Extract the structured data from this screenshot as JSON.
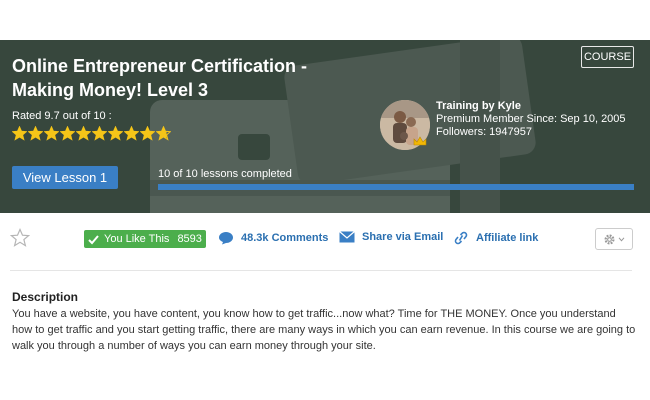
{
  "hero": {
    "badge": "COURSE",
    "title": "Online Entrepreneur Certification - Making Money! Level 3",
    "rating_text": "Rated 9.7 out of 10 :",
    "rating_value": 9.7,
    "rating_max": 10,
    "trainer": {
      "name": "Training by Kyle",
      "member_since": "Premium Member Since: Sep 10, 2005",
      "followers": "Followers: 1947957"
    },
    "view_button": "View Lesson 1",
    "progress_label": "10 of 10 lessons completed",
    "progress_fraction": 1.0
  },
  "actions": {
    "like_label": "You Like This",
    "like_count": "8593",
    "comments": "48.3k Comments",
    "share": "Share via Email",
    "affiliate": "Affiliate link"
  },
  "description": {
    "heading": "Description",
    "text": "You have a website, you have content, you know how to get traffic...now what? Time for THE MONEY. Once you understand how to get traffic and you start getting traffic, there are many ways in which you can earn revenue. In this course we are going to walk you through a number of ways you can earn money through your site."
  },
  "colors": {
    "hero_bg": "#37473d",
    "accent_blue": "#3a7fc5",
    "like_green": "#4cae4c",
    "star_gold": "#f5c518",
    "link_blue": "#2a6fb0"
  },
  "icons": [
    "star-icon",
    "check-icon",
    "comment-icon",
    "envelope-icon",
    "link-icon",
    "gear-icon",
    "chevron-down-icon",
    "crown-icon"
  ]
}
